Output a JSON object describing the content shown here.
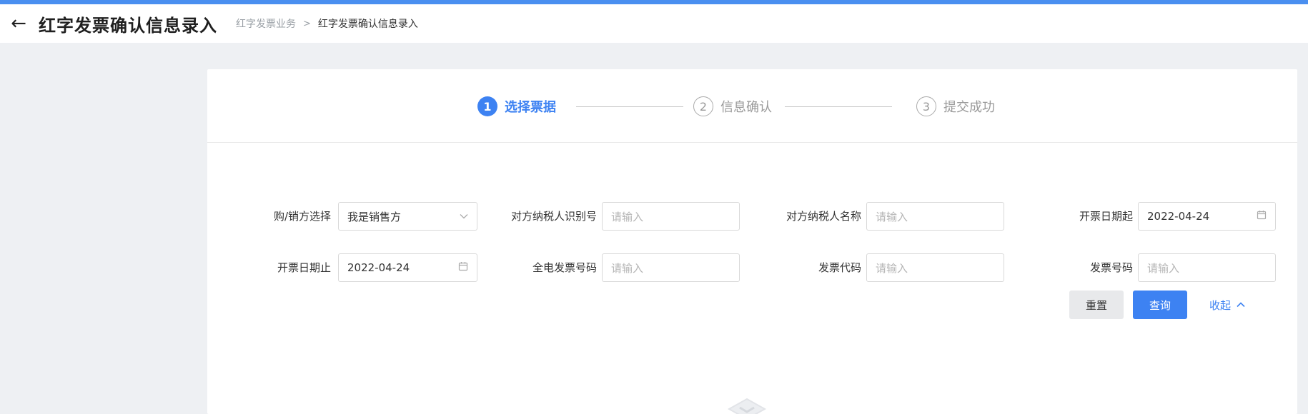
{
  "header": {
    "title": "红字发票确认信息录入",
    "breadcrumb": {
      "parent": "红字发票业务",
      "separator": ">",
      "current": "红字发票确认信息录入"
    },
    "back_icon": "←"
  },
  "steps": [
    {
      "number": "1",
      "label": "选择票据",
      "state": "active"
    },
    {
      "number": "2",
      "label": "信息确认",
      "state": "idle"
    },
    {
      "number": "3",
      "label": "提交成功",
      "state": "idle"
    }
  ],
  "form": {
    "buyer_seller": {
      "label": "购/销方选择",
      "value": "我是销售方"
    },
    "taxpayer_id": {
      "label": "对方纳税人识别号",
      "placeholder": "请输入"
    },
    "taxpayer_name": {
      "label": "对方纳税人名称",
      "placeholder": "请输入"
    },
    "date_start": {
      "label": "开票日期起",
      "value": "2022-04-24"
    },
    "date_end": {
      "label": "开票日期止",
      "value": "2022-04-24"
    },
    "full_e_invoice_no": {
      "label": "全电发票号码",
      "placeholder": "请输入"
    },
    "invoice_code": {
      "label": "发票代码",
      "placeholder": "请输入"
    },
    "invoice_no": {
      "label": "发票号码",
      "placeholder": "请输入"
    }
  },
  "actions": {
    "reset": "重置",
    "query": "查询",
    "collapse": "收起"
  },
  "colors": {
    "accent": "#3d82f2",
    "top_bar": "#4a8ff0"
  }
}
